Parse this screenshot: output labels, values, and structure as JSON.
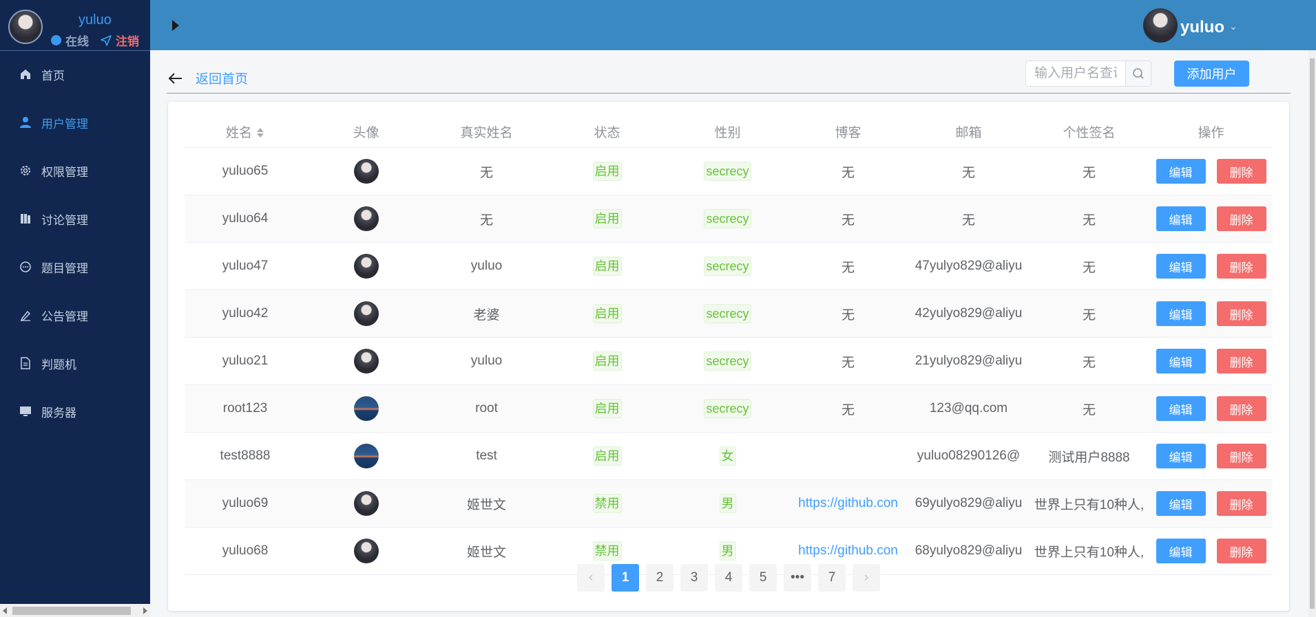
{
  "sidebar": {
    "username": "yuluo",
    "status": "在线",
    "logout": "注销",
    "items": [
      {
        "label": "首页"
      },
      {
        "label": "用户管理"
      },
      {
        "label": "权限管理"
      },
      {
        "label": "讨论管理"
      },
      {
        "label": "题目管理"
      },
      {
        "label": "公告管理"
      },
      {
        "label": "判题机"
      },
      {
        "label": "服务器"
      }
    ],
    "active_index": 1
  },
  "header": {
    "username": "yuluo"
  },
  "toolbar": {
    "back_label": "返回首页",
    "search_placeholder": "输入用户名查询",
    "add_label": "添加用户"
  },
  "table": {
    "columns": [
      "姓名",
      "头像",
      "真实姓名",
      "状态",
      "性别",
      "博客",
      "邮箱",
      "个性签名",
      "操作"
    ],
    "edit_label": "编辑",
    "delete_label": "删除",
    "rows": [
      {
        "name": "yuluo65",
        "avatar": "person",
        "realname": "无",
        "status": "启用",
        "gender": "secrecy",
        "blog": "无",
        "email": "无",
        "sign": "无"
      },
      {
        "name": "yuluo64",
        "avatar": "person",
        "realname": "无",
        "status": "启用",
        "gender": "secrecy",
        "blog": "无",
        "email": "无",
        "sign": "无"
      },
      {
        "name": "yuluo47",
        "avatar": "person",
        "realname": "yuluo",
        "status": "启用",
        "gender": "secrecy",
        "blog": "无",
        "email": "47yulyo829@aliyu",
        "sign": "无"
      },
      {
        "name": "yuluo42",
        "avatar": "person",
        "realname": "老婆",
        "status": "启用",
        "gender": "secrecy",
        "blog": "无",
        "email": "42yulyo829@aliyu",
        "sign": "无"
      },
      {
        "name": "yuluo21",
        "avatar": "person",
        "realname": "yuluo",
        "status": "启用",
        "gender": "secrecy",
        "blog": "无",
        "email": "21yulyo829@aliyu",
        "sign": "无"
      },
      {
        "name": "root123",
        "avatar": "sea",
        "realname": "root",
        "status": "启用",
        "gender": "secrecy",
        "blog": "无",
        "email": "123@qq.com",
        "sign": "无"
      },
      {
        "name": "test8888",
        "avatar": "sea",
        "realname": "test",
        "status": "启用",
        "gender": "女",
        "blog": "",
        "email": "yuluo08290126@",
        "sign": "测试用户8888"
      },
      {
        "name": "yuluo69",
        "avatar": "person",
        "realname": "姬世文",
        "status": "禁用",
        "gender": "男",
        "blog": "https://github.con",
        "email": "69yulyo829@aliyu",
        "sign": "世界上只有10种人,"
      },
      {
        "name": "yuluo68",
        "avatar": "person",
        "realname": "姬世文",
        "status": "禁用",
        "gender": "男",
        "blog": "https://github.con",
        "email": "68yulyo829@aliyu",
        "sign": "世界上只有10种人,"
      }
    ]
  },
  "pagination": {
    "prev": "‹",
    "next": "›",
    "pages": [
      "1",
      "2",
      "3",
      "4",
      "5",
      "•••",
      "7"
    ],
    "current": "1"
  }
}
